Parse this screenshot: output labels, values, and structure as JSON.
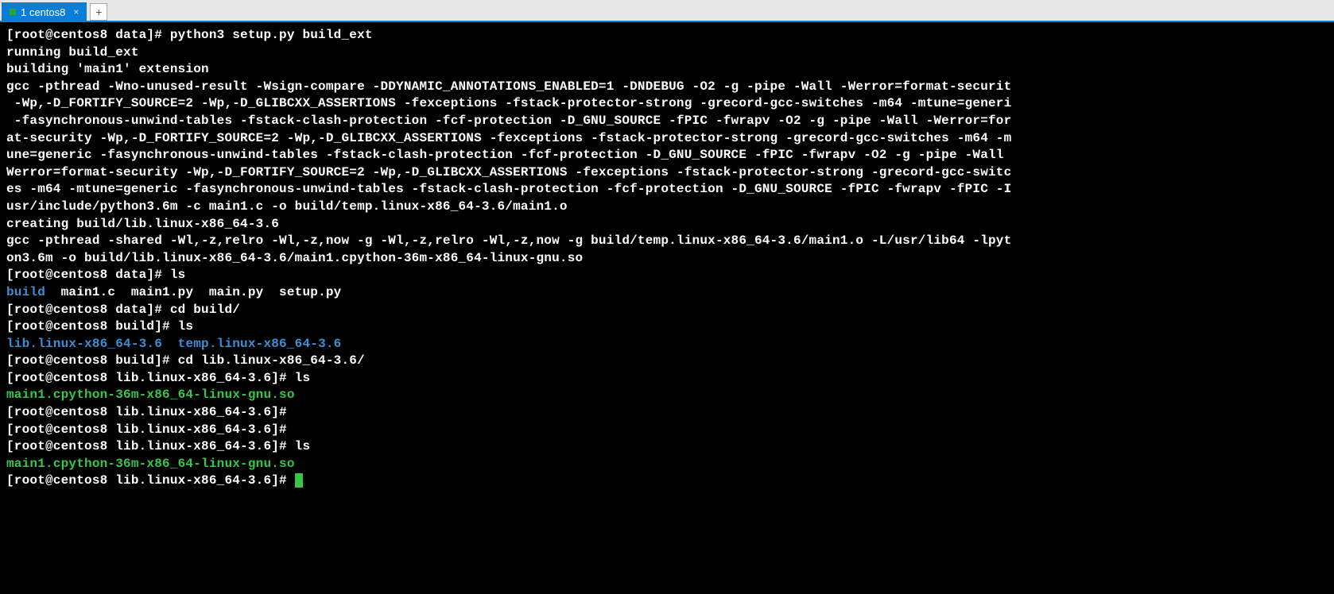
{
  "tabs": {
    "active_label": "1 centos8",
    "close_glyph": "×",
    "add_glyph": "+"
  },
  "terminal": {
    "lines": [
      {
        "segments": [
          {
            "text": "[root@centos8 data]# python3 setup.py build_ext"
          }
        ]
      },
      {
        "segments": [
          {
            "text": "running build_ext"
          }
        ]
      },
      {
        "segments": [
          {
            "text": "building 'main1' extension"
          }
        ]
      },
      {
        "segments": [
          {
            "text": "gcc -pthread -Wno-unused-result -Wsign-compare -DDYNAMIC_ANNOTATIONS_ENABLED=1 -DNDEBUG -O2 -g -pipe -Wall -Werror=format-securit"
          }
        ]
      },
      {
        "segments": [
          {
            "text": " -Wp,-D_FORTIFY_SOURCE=2 -Wp,-D_GLIBCXX_ASSERTIONS -fexceptions -fstack-protector-strong -grecord-gcc-switches -m64 -mtune=generi"
          }
        ]
      },
      {
        "segments": [
          {
            "text": " -fasynchronous-unwind-tables -fstack-clash-protection -fcf-protection -D_GNU_SOURCE -fPIC -fwrapv -O2 -g -pipe -Wall -Werror=for"
          }
        ]
      },
      {
        "segments": [
          {
            "text": "at-security -Wp,-D_FORTIFY_SOURCE=2 -Wp,-D_GLIBCXX_ASSERTIONS -fexceptions -fstack-protector-strong -grecord-gcc-switches -m64 -m"
          }
        ]
      },
      {
        "segments": [
          {
            "text": "une=generic -fasynchronous-unwind-tables -fstack-clash-protection -fcf-protection -D_GNU_SOURCE -fPIC -fwrapv -O2 -g -pipe -Wall "
          }
        ]
      },
      {
        "segments": [
          {
            "text": "Werror=format-security -Wp,-D_FORTIFY_SOURCE=2 -Wp,-D_GLIBCXX_ASSERTIONS -fexceptions -fstack-protector-strong -grecord-gcc-switc"
          }
        ]
      },
      {
        "segments": [
          {
            "text": "es -m64 -mtune=generic -fasynchronous-unwind-tables -fstack-clash-protection -fcf-protection -D_GNU_SOURCE -fPIC -fwrapv -fPIC -I"
          }
        ]
      },
      {
        "segments": [
          {
            "text": "usr/include/python3.6m -c main1.c -o build/temp.linux-x86_64-3.6/main1.o"
          }
        ]
      },
      {
        "segments": [
          {
            "text": "creating build/lib.linux-x86_64-3.6"
          }
        ]
      },
      {
        "segments": [
          {
            "text": "gcc -pthread -shared -Wl,-z,relro -Wl,-z,now -g -Wl,-z,relro -Wl,-z,now -g build/temp.linux-x86_64-3.6/main1.o -L/usr/lib64 -lpyt"
          }
        ]
      },
      {
        "segments": [
          {
            "text": "on3.6m -o build/lib.linux-x86_64-3.6/main1.cpython-36m-x86_64-linux-gnu.so"
          }
        ]
      },
      {
        "segments": [
          {
            "text": "[root@centos8 data]# ls"
          }
        ]
      },
      {
        "segments": [
          {
            "text": "build",
            "cls": "dir-blue"
          },
          {
            "text": "  main1.c  main1.py  main.py  setup.py"
          }
        ]
      },
      {
        "segments": [
          {
            "text": "[root@centos8 data]# cd build/"
          }
        ]
      },
      {
        "segments": [
          {
            "text": "[root@centos8 build]# ls"
          }
        ]
      },
      {
        "segments": [
          {
            "text": "lib.linux-x86_64-3.6",
            "cls": "dir-blue"
          },
          {
            "text": "  "
          },
          {
            "text": "temp.linux-x86_64-3.6",
            "cls": "dir-blue"
          }
        ]
      },
      {
        "segments": [
          {
            "text": "[root@centos8 build]# cd lib.linux-x86_64-3.6/"
          }
        ]
      },
      {
        "segments": [
          {
            "text": "[root@centos8 lib.linux-x86_64-3.6]# ls"
          }
        ]
      },
      {
        "segments": [
          {
            "text": "main1.cpython-36m-x86_64-linux-gnu.so",
            "cls": "exe-green"
          }
        ]
      },
      {
        "segments": [
          {
            "text": "[root@centos8 lib.linux-x86_64-3.6]# "
          }
        ]
      },
      {
        "segments": [
          {
            "text": "[root@centos8 lib.linux-x86_64-3.6]# "
          }
        ]
      },
      {
        "segments": [
          {
            "text": "[root@centos8 lib.linux-x86_64-3.6]# ls"
          }
        ]
      },
      {
        "segments": [
          {
            "text": "main1.cpython-36m-x86_64-linux-gnu.so",
            "cls": "exe-green"
          }
        ]
      },
      {
        "segments": [
          {
            "text": "[root@centos8 lib.linux-x86_64-3.6]# "
          }
        ],
        "cursor": true
      }
    ]
  }
}
